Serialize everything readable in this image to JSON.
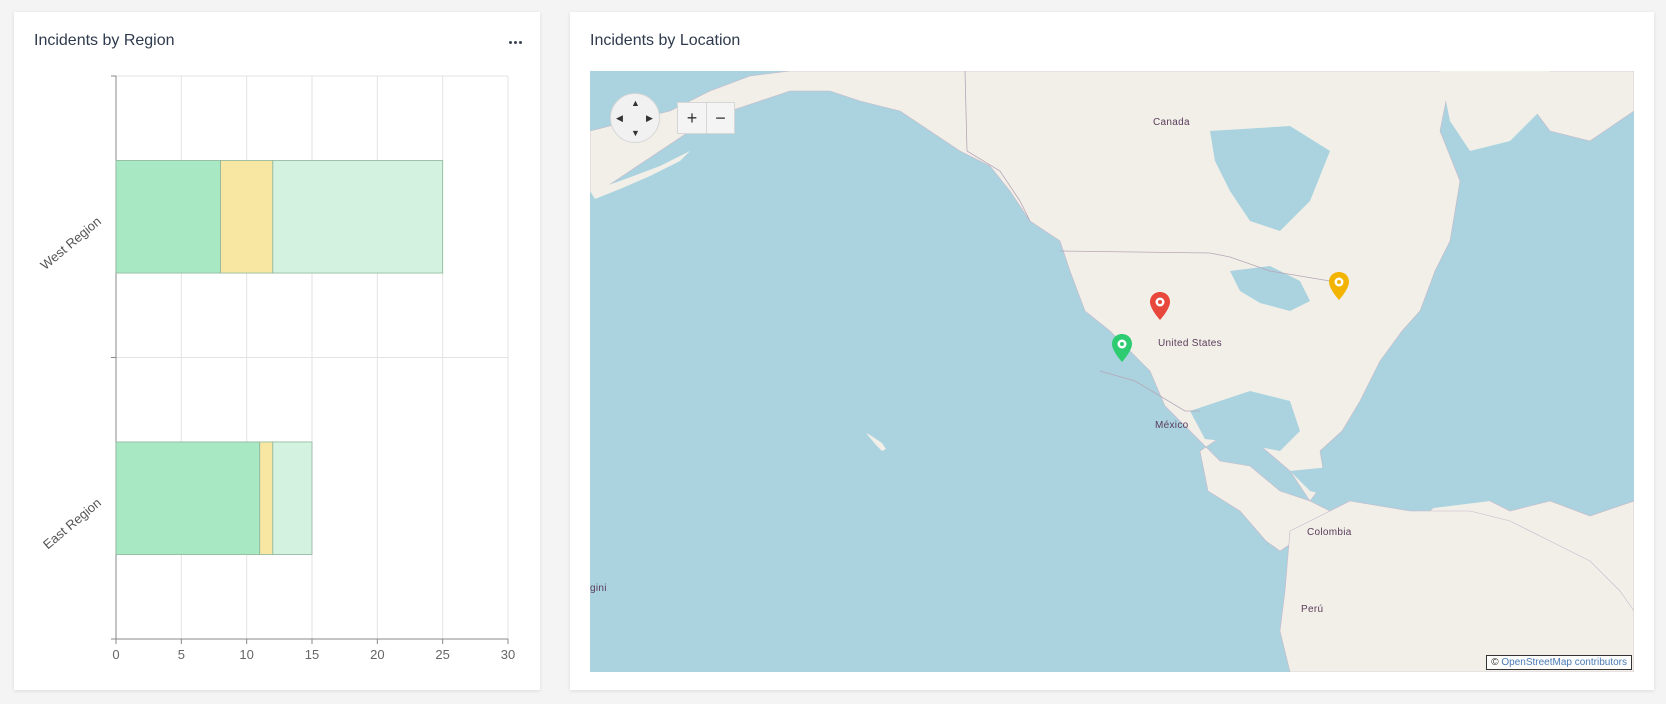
{
  "left_panel": {
    "title": "Incidents by Region",
    "more_icon": "ellipsis-icon"
  },
  "chart_data": {
    "type": "bar",
    "orientation": "horizontal",
    "stacked": true,
    "categories": [
      "West Region",
      "East Region"
    ],
    "series": [
      {
        "values": [
          8,
          11
        ],
        "color": "#a8e8c2"
      },
      {
        "values": [
          4,
          1
        ],
        "color": "#f7e7a3"
      },
      {
        "values": [
          13,
          3
        ],
        "color": "#d3f3e0"
      }
    ],
    "xlim": [
      0,
      30
    ],
    "xticks": [
      0,
      5,
      10,
      15,
      20,
      25,
      30
    ],
    "xlabel": "",
    "ylabel": "",
    "grid": true
  },
  "right_panel": {
    "title": "Incidents by Location",
    "controls": {
      "pan_up": "▲",
      "pan_down": "▼",
      "pan_left": "◀",
      "pan_right": "▶",
      "zoom_in": "+",
      "zoom_out": "−"
    },
    "attribution_prefix": "©",
    "attribution_link": "OpenStreetMap contributors",
    "labels": {
      "canada": "Canada",
      "united_states": "United States",
      "mexico": "México",
      "colombia": "Colombia",
      "peru": "Perú",
      "kiribati_partial": "gini"
    },
    "markers": [
      {
        "name": "red-marker",
        "color": "#e8473b"
      },
      {
        "name": "green-marker",
        "color": "#2ecc71"
      },
      {
        "name": "yellow-marker",
        "color": "#f3b400"
      }
    ]
  }
}
